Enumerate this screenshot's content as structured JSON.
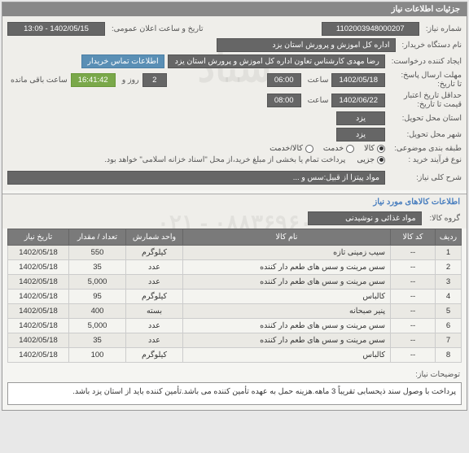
{
  "panel": {
    "title": "جزئیات اطلاعات نیاز"
  },
  "fields": {
    "need_no_label": "شماره نیاز:",
    "need_no": "1102003948000207",
    "announce_label": "تاریخ و ساعت اعلان عمومی:",
    "announce_value": "1402/05/15 - 13:09",
    "buyer_label": "نام دستگاه خریدار:",
    "buyer": "اداره کل اموزش و پرورش استان یزد",
    "requester_label": "ایجاد کننده درخواست:",
    "requester": "رضا مهدی کارشناس تعاون اداره کل اموزش و پرورش استان یزد",
    "contact": "اطلاعات تماس خریدار",
    "deadline_label": "مهلت ارسال پاسخ:",
    "deadline_until_label": "تا تاریخ:",
    "deadline_date": "1402/05/18",
    "time_label": "ساعت",
    "deadline_time": "06:00",
    "days_count": "2",
    "days_and": "روز و",
    "remaining_time": "16:41:42",
    "remaining_label": "ساعت باقی مانده",
    "credit_label": "حداقل تاریخ اعتبار",
    "credit_label2": "قیمت تا تاریخ:",
    "credit_date": "1402/06/22",
    "credit_time": "08:00",
    "province_deliver_label": "استان محل تحویل:",
    "province": "یزد",
    "city_deliver_label": "شهر محل تحویل:",
    "city": "یزد",
    "category_label": "طبقه بندی موضوعی:",
    "cat_goods": "کالا",
    "cat_service": "خدمت",
    "cat_goods_service": "کالا/خدمت",
    "buy_type_label": "نوع فرآیند خرید :",
    "buy_partial": "جزیی",
    "buy_note": "پرداخت تمام یا بخشی از مبلغ خرید،از محل \"اسناد خزانه اسلامی\" خواهد بود.",
    "need_desc_label": "شرح کلی نیاز:",
    "need_desc": "مواد پیتزا از قبیل:سس و ...",
    "items_section": "اطلاعات کالاهای مورد نیاز",
    "group_label": "گروه کالا:",
    "group_value": "مواد غذائی و نوشیدنی",
    "notes_label": "توضیحات نیاز:",
    "notes": "پرداخت با وصول سند ذیحسابی تقریباً 3 ماهه.هزینه حمل به عهده تأمین کننده می باشد.تأمین کننده باید از استان یزد باشد."
  },
  "table": {
    "headers": {
      "row": "ردیف",
      "code": "کد کالا",
      "name": "نام کالا",
      "unit": "واحد شمارش",
      "qty": "تعداد / مقدار",
      "date": "تاریخ نیاز"
    },
    "rows": [
      {
        "n": "1",
        "code": "--",
        "name": "سیب زمینی تازه",
        "unit": "کیلوگرم",
        "qty": "550",
        "date": "1402/05/18"
      },
      {
        "n": "2",
        "code": "--",
        "name": "سس مرینت و سس های طعم دار کننده",
        "unit": "عدد",
        "qty": "35",
        "date": "1402/05/18"
      },
      {
        "n": "3",
        "code": "--",
        "name": "سس مرینت و سس های طعم دار کننده",
        "unit": "عدد",
        "qty": "5,000",
        "date": "1402/05/18"
      },
      {
        "n": "4",
        "code": "--",
        "name": "کالباس",
        "unit": "کیلوگرم",
        "qty": "95",
        "date": "1402/05/18"
      },
      {
        "n": "5",
        "code": "--",
        "name": "پنیر صبحانه",
        "unit": "بسته",
        "qty": "400",
        "date": "1402/05/18"
      },
      {
        "n": "6",
        "code": "--",
        "name": "سس مرینت و سس های طعم دار کننده",
        "unit": "عدد",
        "qty": "5,000",
        "date": "1402/05/18"
      },
      {
        "n": "7",
        "code": "--",
        "name": "سس مرینت و سس های طعم دار کننده",
        "unit": "عدد",
        "qty": "35",
        "date": "1402/05/18"
      },
      {
        "n": "8",
        "code": "--",
        "name": "کالباس",
        "unit": "کیلوگرم",
        "qty": "100",
        "date": "1402/05/18"
      }
    ]
  }
}
